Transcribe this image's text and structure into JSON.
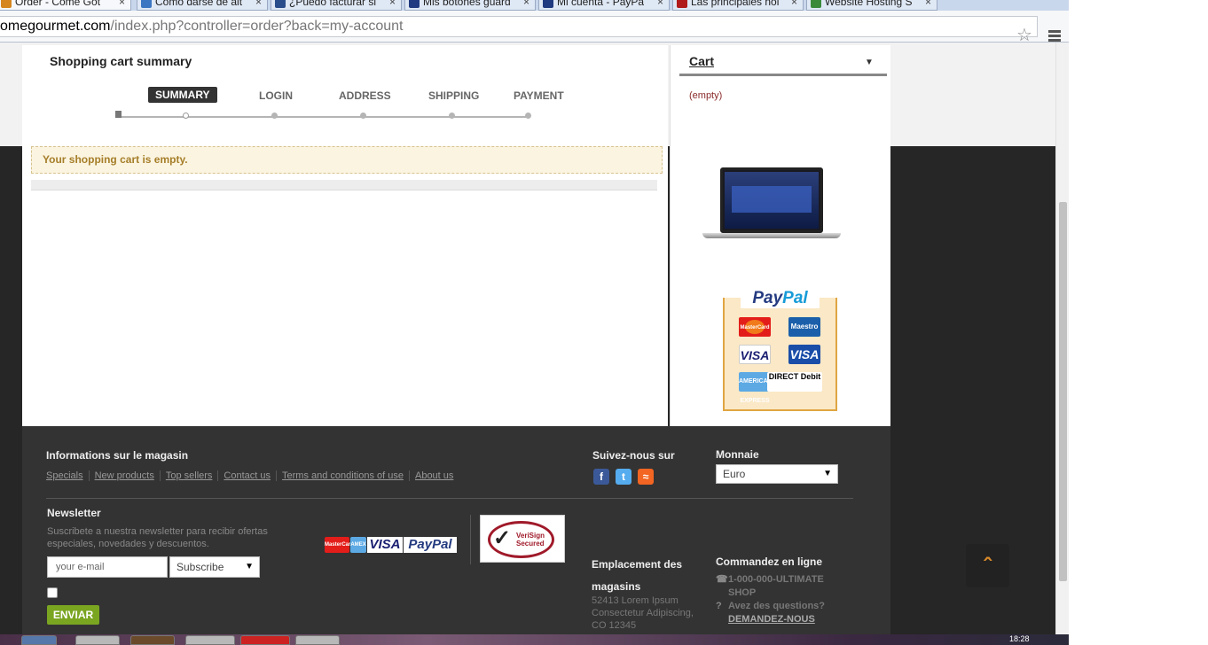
{
  "browser": {
    "tabs": [
      {
        "label": "Order - Come Got",
        "favicon_color": "#d6861e"
      },
      {
        "label": "Cómo darse de alt",
        "favicon_color": "#3a76c2"
      },
      {
        "label": "¿Puedo facturar si",
        "favicon_color": "#2a4e8c"
      },
      {
        "label": "Mis botones guard",
        "favicon_color": "#1f3a80"
      },
      {
        "label": "Mi cuenta - PayPa",
        "favicon_color": "#1f3a80"
      },
      {
        "label": "Las principales noi",
        "favicon_color": "#b01a1a"
      },
      {
        "label": "Website Hosting S",
        "favicon_color": "#3a8a3a"
      }
    ],
    "url_host": "omegourmet.com",
    "url_path": "/index.php?controller=order?back=my-account",
    "star_icon": "star-icon",
    "menu_icon": "hamburger-menu-icon"
  },
  "order": {
    "title": "Shopping cart summary",
    "steps": [
      "SUMMARY",
      "LOGIN",
      "ADDRESS",
      "SHIPPING",
      "PAYMENT"
    ],
    "active_step": "SUMMARY",
    "alert": "Your shopping cart is empty."
  },
  "cart": {
    "title": "Cart",
    "empty_text": "(empty)"
  },
  "promo": {
    "paypal_logo_1": "Pay",
    "paypal_logo_2": "Pal",
    "cards": [
      "MasterCard",
      "Maestro",
      "VISA",
      "VISA",
      "AMERICAN EXPRESS",
      "DIRECT Debit"
    ]
  },
  "footer": {
    "info_title": "Informations sur le magasin",
    "links": [
      "Specials",
      "New products",
      "Top sellers",
      "Contact us",
      "Terms and conditions of use",
      "About us"
    ],
    "follow_title": "Suivez-nous sur",
    "social_icons": [
      "facebook-icon",
      "twitter-icon",
      "rss-icon"
    ],
    "currency_title": "Monnaie",
    "currency_value": "Euro",
    "newsletter_title": "Newsletter",
    "newsletter_text": "Suscribete a nuestra newsletter para recibir ofertas especiales, novedades y descuentos.",
    "email_placeholder": "your e-mail",
    "subscribe_value": "Subscribe",
    "send_label": "ENVIAR",
    "payment_logos": [
      "MasterCard",
      "AMEX",
      "VISA",
      "PayPal"
    ],
    "verisign_text_1": "VeriSign",
    "verisign_text_2": "Secured",
    "location_title": "Emplacement des magasins",
    "location_address": "52413 Lorem Ipsum Consectetur Adipiscing, CO 12345",
    "order_title": "Commandez en ligne",
    "phone": "1-000-000-ULTIMATE SHOP",
    "question": "Avez des questions?",
    "ask_link": "DEMANDEZ-NOUS"
  },
  "taskbar": {
    "clock": "18:28"
  }
}
